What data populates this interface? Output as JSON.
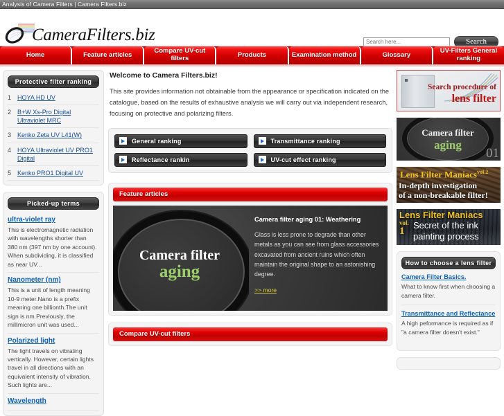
{
  "browser": {
    "title": "Analysis of Camera Filters | Camera Filters.biz"
  },
  "header": {
    "logo_text": "CameraFilters.biz",
    "search": {
      "placeholder": "Search here...",
      "value": "",
      "button_label": "Search"
    }
  },
  "nav": {
    "items": [
      {
        "label": "Home"
      },
      {
        "label": "Feature articles"
      },
      {
        "label": "Compare UV-cut filters"
      },
      {
        "label": "Products"
      },
      {
        "label": "Examination method"
      },
      {
        "label": "Glossary"
      },
      {
        "label": "UV-Filters General ranking"
      }
    ]
  },
  "left_sidebar": {
    "ranking": {
      "title": "Protective filter ranking",
      "items": [
        {
          "num": "1",
          "label": "HOYA HD UV"
        },
        {
          "num": "2",
          "label": "B+W Xs-Pro Digital Ultraviolet MRC"
        },
        {
          "num": "3",
          "label": "Kenko Zeta UV L41(W)"
        },
        {
          "num": "4",
          "label": "HOYA Ultraviolet UV PRO1 Digital"
        },
        {
          "num": "5",
          "label": "Kenko PRO1 Digital UV"
        }
      ]
    },
    "terms": {
      "title": "Picked-up terms",
      "items": [
        {
          "term": "ultra-violet ray",
          "text": "This is electromagnetic radiation with wavelengths shorter than 380 nm (397 nm by one account). When subdividing, it is classified as near UV..."
        },
        {
          "term": "Nanometer (nm)",
          "text": "This is a unit of length meaning 10-9 meter.Nano is a prefix meaning one billionth.The unit sign is nm.Previously, the millimicron unit was used..."
        },
        {
          "term": "Polarized light",
          "text": "The light travels on vibrating vertically. However, certain lights travel in all directions with an equivalent intensity of vibration. Such lights are..."
        },
        {
          "term": "Wavelength",
          "text": ""
        }
      ]
    }
  },
  "main": {
    "welcome_title": "Welcome to Camera Filters.biz!",
    "welcome_body": "This site provides information not obtainable from the appearance or specification indicated on the catalogue, based on the results of exhaustive analysis we will carry out via independent research, focusing on protective and polarizing filters.",
    "ranking_buttons": [
      {
        "label": "General ranking"
      },
      {
        "label": "Transmittance ranking"
      },
      {
        "label": "Reflectance rankin"
      },
      {
        "label": "UV-cut effect ranking"
      }
    ],
    "feature_section": {
      "heading": "Feature articles",
      "article": {
        "image_line1": "Camera filter",
        "image_line2": "aging",
        "title": "Camera filter aging 01: Weathering",
        "body": "Glass is less prone to degrade than other metals as you can see from glass accessories excavated from ancient ruins which often maintain the original shape to an astonishing degree.",
        "more_label": ">> more"
      }
    },
    "compare_section": {
      "heading": "Compare UV-cut filters"
    }
  },
  "right_sidebar": {
    "banners": [
      {
        "id": "search-procedure",
        "line1": "Search procedure of",
        "line2": "lens filter"
      },
      {
        "id": "camera-filter-aging",
        "line1": "Camera filter",
        "line2": "aging",
        "number": "01"
      },
      {
        "id": "lens-filter-maniacs-vol2",
        "heading": "Lens Filter Maniacs",
        "vol": "vol.2",
        "line1": "In-depth investigation",
        "line2": "of a non-breakable filter!"
      },
      {
        "id": "lens-filter-maniacs-vol1",
        "heading": "Lens Filter Maniacs",
        "vol_word": "vol.",
        "vol_num": "1",
        "line1": "Secret of the ink",
        "line2": "painting process"
      }
    ],
    "howto": {
      "title": "How to choose a lens filter",
      "items": [
        {
          "link": "Camera Filter Basics.",
          "desc": "What to know first when choosing a camera filter."
        },
        {
          "link": "Transmittance and Reflectance",
          "desc": "A high peformance is required as if \"a camera filter doesn't exist.\""
        }
      ]
    }
  }
}
